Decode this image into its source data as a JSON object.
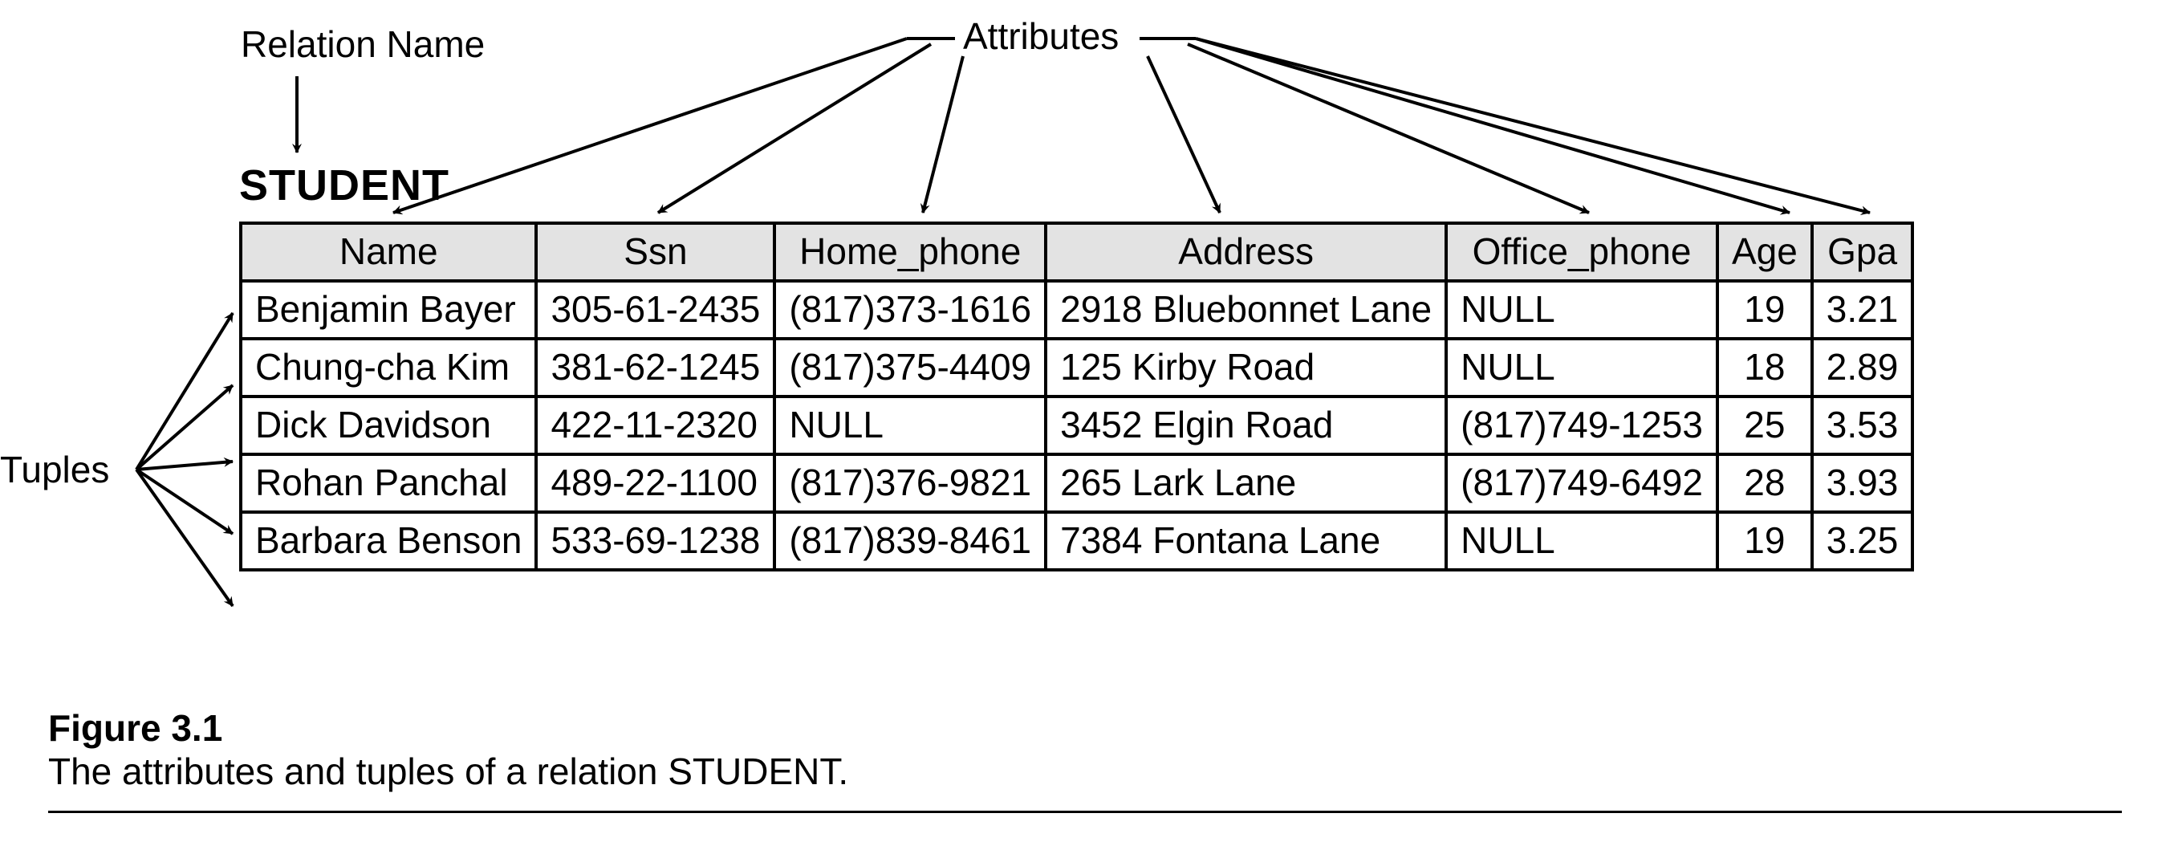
{
  "labels": {
    "relation_name": "Relation Name",
    "attributes": "Attributes",
    "tuples": "Tuples"
  },
  "relation_title": "STUDENT",
  "columns": [
    "Name",
    "Ssn",
    "Home_phone",
    "Address",
    "Office_phone",
    "Age",
    "Gpa"
  ],
  "rows": [
    {
      "Name": "Benjamin Bayer",
      "Ssn": "305-61-2435",
      "Home_phone": "(817)373-1616",
      "Address": "2918 Bluebonnet Lane",
      "Office_phone": "NULL",
      "Age": "19",
      "Gpa": "3.21"
    },
    {
      "Name": "Chung-cha Kim",
      "Ssn": "381-62-1245",
      "Home_phone": "(817)375-4409",
      "Address": "125 Kirby Road",
      "Office_phone": "NULL",
      "Age": "18",
      "Gpa": "2.89"
    },
    {
      "Name": "Dick Davidson",
      "Ssn": "422-11-2320",
      "Home_phone": "NULL",
      "Address": "3452 Elgin Road",
      "Office_phone": "(817)749-1253",
      "Age": "25",
      "Gpa": "3.53"
    },
    {
      "Name": "Rohan Panchal",
      "Ssn": "489-22-1100",
      "Home_phone": "(817)376-9821",
      "Address": "265 Lark Lane",
      "Office_phone": "(817)749-6492",
      "Age": "28",
      "Gpa": "3.93"
    },
    {
      "Name": "Barbara Benson",
      "Ssn": "533-69-1238",
      "Home_phone": "(817)839-8461",
      "Address": "7384 Fontana Lane",
      "Office_phone": "NULL",
      "Age": "19",
      "Gpa": "3.25"
    }
  ],
  "caption": {
    "title": "Figure 3.1",
    "text": "The attributes and tuples of a relation STUDENT."
  },
  "chart_data": {
    "type": "table",
    "title": "STUDENT",
    "annotations": [
      "Relation Name",
      "Attributes",
      "Tuples"
    ],
    "columns": [
      "Name",
      "Ssn",
      "Home_phone",
      "Address",
      "Office_phone",
      "Age",
      "Gpa"
    ],
    "rows": [
      [
        "Benjamin Bayer",
        "305-61-2435",
        "(817)373-1616",
        "2918 Bluebonnet Lane",
        "NULL",
        19,
        3.21
      ],
      [
        "Chung-cha Kim",
        "381-62-1245",
        "(817)375-4409",
        "125 Kirby Road",
        "NULL",
        18,
        2.89
      ],
      [
        "Dick Davidson",
        "422-11-2320",
        "NULL",
        "3452 Elgin Road",
        "(817)749-1253",
        25,
        3.53
      ],
      [
        "Rohan Panchal",
        "489-22-1100",
        "(817)376-9821",
        "265 Lark Lane",
        "(817)749-6492",
        28,
        3.93
      ],
      [
        "Barbara Benson",
        "533-69-1238",
        "(817)839-8461",
        "7384 Fontana Lane",
        "NULL",
        19,
        3.25
      ]
    ],
    "caption": "Figure 3.1 The attributes and tuples of a relation STUDENT."
  }
}
